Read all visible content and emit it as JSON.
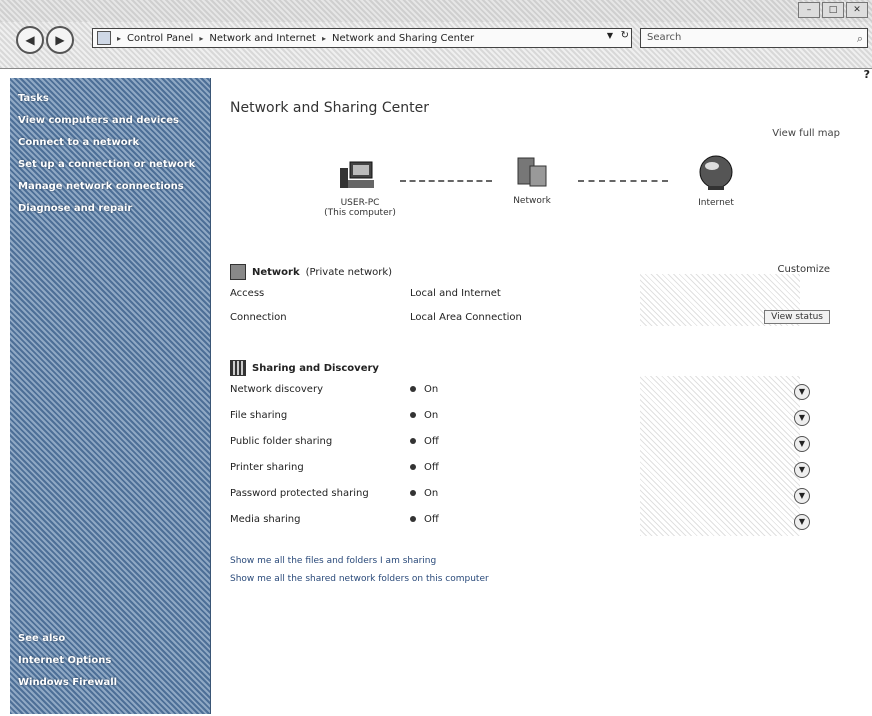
{
  "window": {
    "buttons": [
      "–",
      "□",
      "✕"
    ]
  },
  "address": {
    "crumbs": [
      "Control Panel",
      "Network and Internet",
      "Network and Sharing Center"
    ],
    "search_placeholder": "Search"
  },
  "sidebar": {
    "tasks_label": "Tasks",
    "items": [
      "View computers and devices",
      "Connect to a network",
      "Set up a connection or network",
      "Manage network connections",
      "Diagnose and repair"
    ],
    "see_also_label": "See also",
    "bottom": [
      "Internet Options",
      "Windows Firewall"
    ]
  },
  "main": {
    "title": "Network and Sharing Center",
    "view_full_map": "View full map",
    "map": {
      "computer_name": "USER-PC",
      "computer_sub": "(This computer)",
      "network_label": "Network",
      "internet_label": "Internet"
    },
    "network": {
      "name": "Network",
      "type": "(Private network)",
      "customize": "Customize",
      "access_label": "Access",
      "access_value": "Local and Internet",
      "connection_label": "Connection",
      "connection_value": "Local Area Connection",
      "view_status": "View status"
    },
    "sharing": {
      "title": "Sharing and Discovery",
      "rows": [
        {
          "label": "Network discovery",
          "value": "On"
        },
        {
          "label": "File sharing",
          "value": "On"
        },
        {
          "label": "Public folder sharing",
          "value": "Off"
        },
        {
          "label": "Printer sharing",
          "value": "Off"
        },
        {
          "label": "Password protected sharing",
          "value": "On"
        },
        {
          "label": "Media sharing",
          "value": "Off"
        }
      ]
    },
    "links": [
      "Show me all the files and folders I am sharing",
      "Show me all the shared network folders on this computer"
    ]
  }
}
